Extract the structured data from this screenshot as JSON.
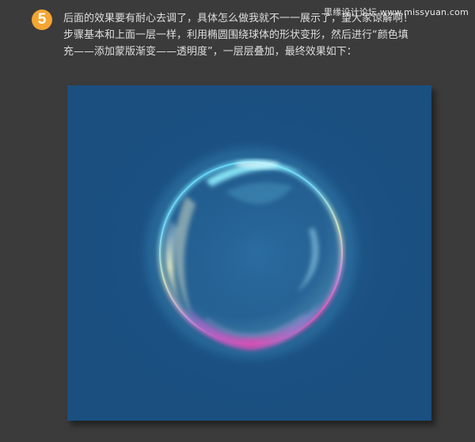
{
  "watermark": "思缘设计论坛 www.missyuan.com",
  "step": {
    "number": "5",
    "lines": [
      "后面的效果要有耐心去调了，具体怎么做我就不一一展示了，望大家谅解啊！",
      "步骤基本和上面一层一样，利用椭圆围绕球体的形状变形，然后进行“颜色填",
      "充——添加蒙版渐变——透明度”，一层层叠加，最终效果如下："
    ]
  },
  "canvas": {
    "background_color": "#1a4f80",
    "subject": "bubble-sphere"
  },
  "colors": {
    "page_background": "#3b3b3c",
    "badge": "#f3a632",
    "text": "#dedede"
  }
}
